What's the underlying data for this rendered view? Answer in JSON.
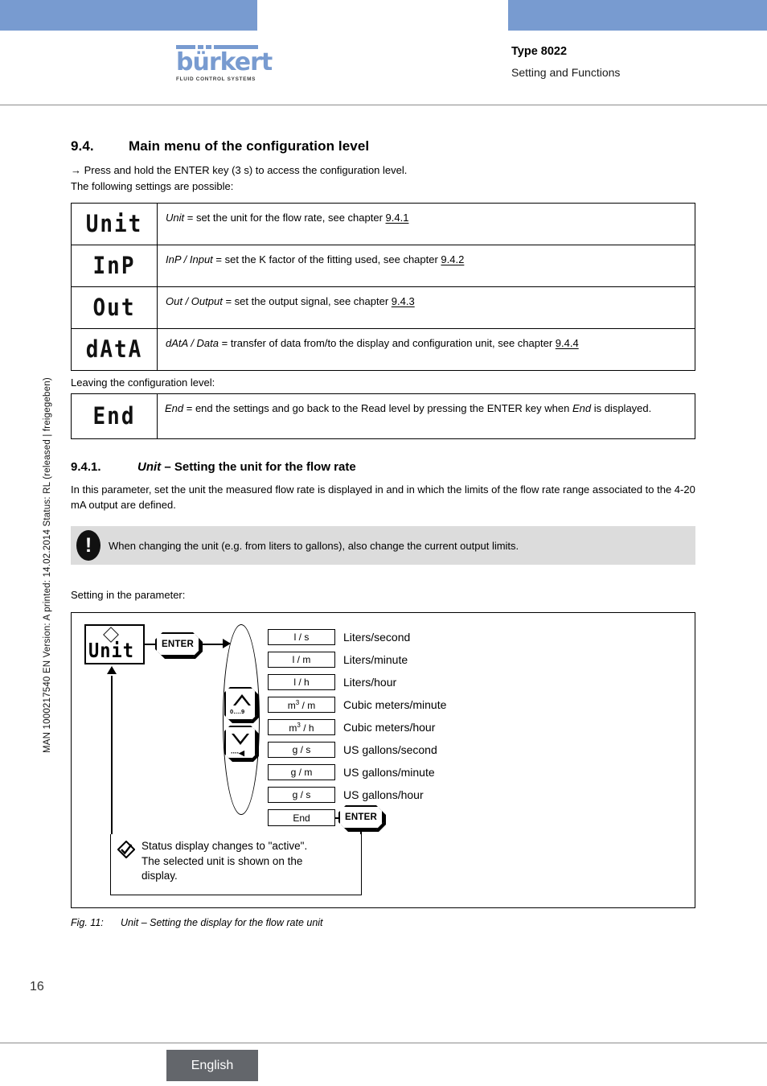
{
  "header": {
    "logo_word": "bürkert",
    "logo_tagline": "FLUID CONTROL SYSTEMS",
    "type_title": "Type 8022",
    "subtitle": "Setting and Functions",
    "bar_color": "#789BD0"
  },
  "sidebar": {
    "doc_ref": "MAN 1000217540  EN  Version: A   printed: 14.02.2014 Status: RL (released | freigegeben)",
    "page_number": "16"
  },
  "section": {
    "number": "9.4.",
    "title": "Main menu of the configuration level",
    "intro_line1": "→ Press and hold the ENTER key (3 s) to access the configuration level.",
    "intro_line2": "The following settings are possible:"
  },
  "menu_table": {
    "rows": [
      {
        "lcd": "Unit",
        "term": "Unit",
        "desc_before": " = set the unit for the flow rate, see chapter ",
        "xref": "9.4.1"
      },
      {
        "lcd": "InP",
        "term": "InP / Input",
        "desc_before": " = set the K factor of the fitting used, see chapter ",
        "xref": "9.4.2"
      },
      {
        "lcd": "Out",
        "term": "Out / Output",
        "desc_before": " = set the output signal, see chapter ",
        "xref": "9.4.3"
      },
      {
        "lcd": "dAtA",
        "term": "dAtA / Data",
        "desc_before": " = transfer of data from/to the display and configuration unit, see chapter ",
        "xref": "9.4.4"
      }
    ]
  },
  "leaving": {
    "label": "Leaving the configuration level:",
    "lcd": "End",
    "term": "End",
    "desc_mid": " = end the settings and go back to the Read level by pressing the ENTER key when ",
    "term2": "End",
    "desc_end": " is displayed."
  },
  "subsection": {
    "number": "9.4.1.",
    "title_italic": "Unit",
    "title_rest": " – Setting the unit for the flow rate",
    "paragraph": "In this parameter, set the unit the measured flow rate is displayed in and in which the limits of the flow rate range associated to the 4-20 mA output are defined."
  },
  "note": {
    "icon": "exclamation-icon",
    "text": "When changing the unit (e.g. from liters to gallons), also change the current output limits.",
    "background": "#dcdcdc"
  },
  "setting_label": "Setting in the parameter:",
  "figure": {
    "display": {
      "lcd_text": "Unit",
      "status_icon": "diamond-icon"
    },
    "enter_top_label": "ENTER",
    "enter_bottom_label": "ENTER",
    "nav_up": {
      "icon": "triangle-up-icon",
      "label": "0....9"
    },
    "nav_down": {
      "icon": "triangle-down-icon",
      "label": "····◀"
    },
    "units": [
      {
        "code": "l / s",
        "sup": "",
        "name": "Liters/second"
      },
      {
        "code": "l / m",
        "sup": "",
        "name": "Liters/minute"
      },
      {
        "code": "l / h",
        "sup": "",
        "name": "Liters/hour"
      },
      {
        "code": "m / m",
        "sup": "3",
        "name": "Cubic meters/minute"
      },
      {
        "code": "m / h",
        "sup": "3",
        "name": "Cubic meters/hour"
      },
      {
        "code": "g / s",
        "sup": "",
        "name": "US gallons/second"
      },
      {
        "code": "g / m",
        "sup": "",
        "name": "US gallons/minute"
      },
      {
        "code": "g / s",
        "sup": "",
        "name": "US gallons/hour"
      }
    ],
    "end_box": "End",
    "status_note": {
      "icon": "check-diamond-icon",
      "line1": "Status display changes to \"active\".",
      "line2": "The selected unit is shown on the",
      "line3": "display."
    }
  },
  "figure_caption": {
    "label": "Fig. 11:",
    "text": "Unit – Setting the display for the flow rate unit"
  },
  "footer": {
    "language": "English",
    "badge_color": "#63666b"
  }
}
